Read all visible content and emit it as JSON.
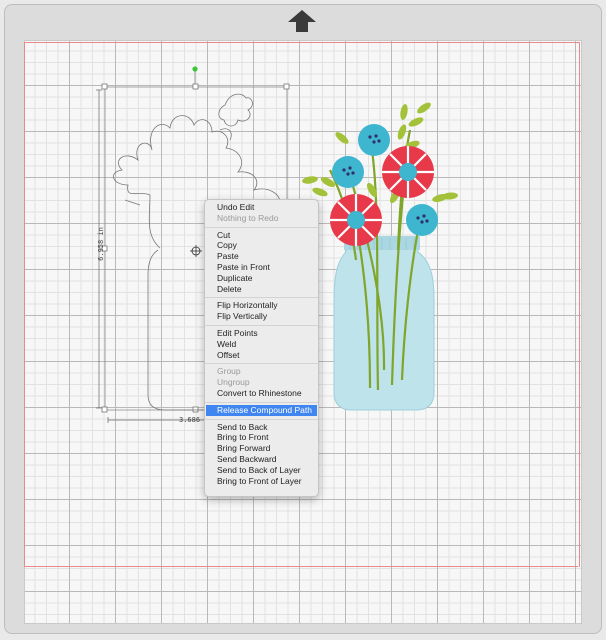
{
  "canvas": {
    "upload_arrow_icon": "up-arrow-icon",
    "cut_border_color": "#e88a8a",
    "grid_color": "#b9b9b9"
  },
  "selection": {
    "height_label": "6.958 in",
    "width_label": "3.686"
  },
  "artwork": {
    "jar_color": "#bfe3ea",
    "flower_red": "#e8394a",
    "flower_blue": "#3fb6cf",
    "leaf_green": "#a3c23a"
  },
  "context_menu": {
    "groups": [
      [
        {
          "label": "Undo Edit",
          "enabled": true
        },
        {
          "label": "Nothing to Redo",
          "enabled": false
        }
      ],
      [
        {
          "label": "Cut",
          "enabled": true
        },
        {
          "label": "Copy",
          "enabled": true
        },
        {
          "label": "Paste",
          "enabled": true
        },
        {
          "label": "Paste in Front",
          "enabled": true
        },
        {
          "label": "Duplicate",
          "enabled": true
        },
        {
          "label": "Delete",
          "enabled": true
        }
      ],
      [
        {
          "label": "Flip Horizontally",
          "enabled": true
        },
        {
          "label": "Flip Vertically",
          "enabled": true
        }
      ],
      [
        {
          "label": "Edit Points",
          "enabled": true
        },
        {
          "label": "Weld",
          "enabled": true
        },
        {
          "label": "Offset",
          "enabled": true
        }
      ],
      [
        {
          "label": "Group",
          "enabled": false
        },
        {
          "label": "Ungroup",
          "enabled": false
        },
        {
          "label": "Convert to Rhinestone",
          "enabled": true
        }
      ],
      [
        {
          "label": "Release Compound Path",
          "enabled": true,
          "selected": true
        }
      ],
      [
        {
          "label": "Send to Back",
          "enabled": true
        },
        {
          "label": "Bring to Front",
          "enabled": true
        },
        {
          "label": "Bring Forward",
          "enabled": true
        },
        {
          "label": "Send Backward",
          "enabled": true
        },
        {
          "label": "Send to Back of Layer",
          "enabled": true
        },
        {
          "label": "Bring to Front of Layer",
          "enabled": true
        }
      ]
    ]
  }
}
